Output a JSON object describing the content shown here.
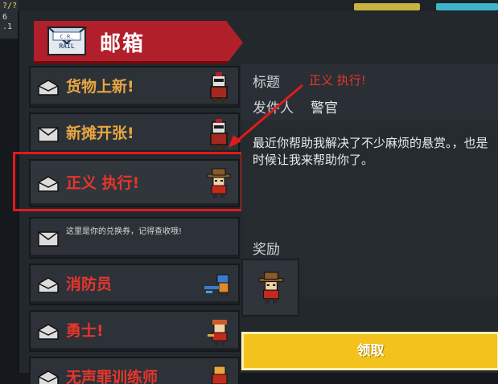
{
  "hud": {
    "left_text": "?/?\n6\n.1"
  },
  "header": {
    "title": "邮箱",
    "banner_icon": "mail-envelope-icon",
    "banner_icon_text": "RAIL"
  },
  "mail_list": [
    {
      "label": "货物上新!",
      "color": "orange",
      "envelope": "opened",
      "avatar": "robot-knight-avatar"
    },
    {
      "label": "新摊开张!",
      "color": "orange",
      "envelope": "closed",
      "avatar": "robot-knight-avatar"
    },
    {
      "label": "正义 执行!",
      "color": "red",
      "envelope": "opened",
      "avatar": "cowboy-officer-avatar"
    },
    {
      "label": "这里是你的兑换券，记得查收哦!",
      "color": "white",
      "envelope": "closed",
      "avatar": ""
    },
    {
      "label": "消防员",
      "color": "red",
      "envelope": "opened",
      "avatar": "firefighter-avatar"
    },
    {
      "label": "勇士!",
      "color": "red",
      "envelope": "opened",
      "avatar": "warrior-avatar"
    },
    {
      "label": "无声罪训练师",
      "color": "red",
      "envelope": "opened",
      "avatar": "trainer-avatar"
    }
  ],
  "detail": {
    "subject_label": "标题",
    "subject_value": "正义 执行!",
    "sender_label": "发件人",
    "sender_value": "警官",
    "body": "最近你帮助我解决了不少麻烦的悬赏。，也是时候让我来帮助你了。",
    "reward_label": "奖励",
    "reward_item": "cowboy-officer-avatar",
    "claim_label": "领取"
  },
  "annotation": {
    "highlight_color": "#e11b1b"
  }
}
